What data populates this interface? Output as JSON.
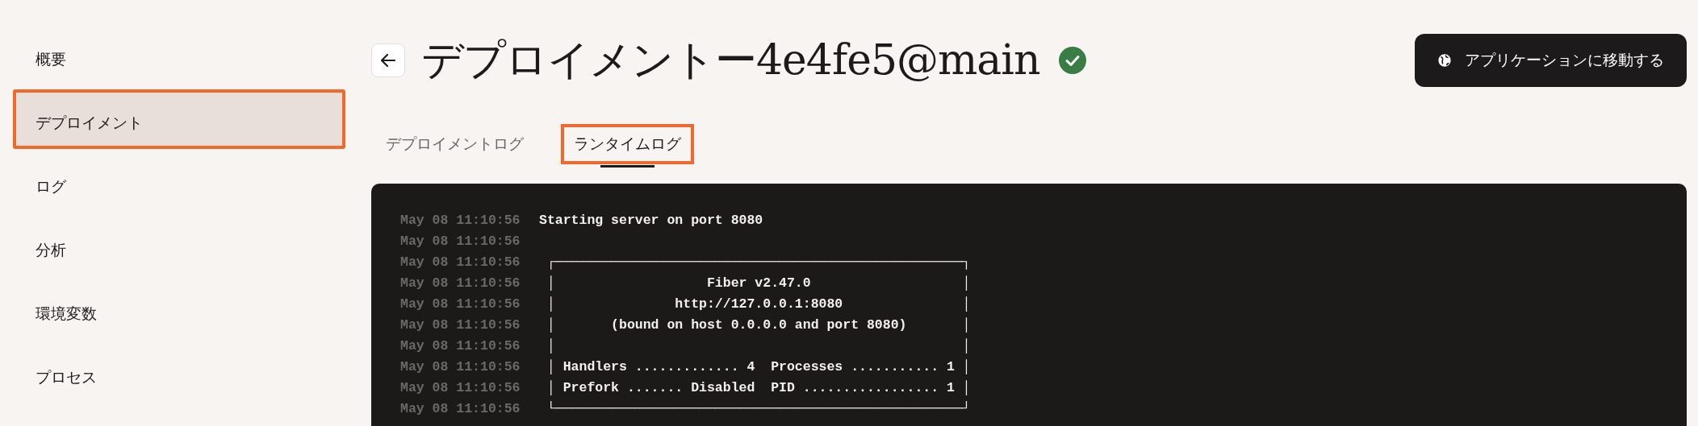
{
  "sidebar": {
    "items": [
      {
        "label": "概要",
        "selected": false,
        "highlighted": false
      },
      {
        "label": "デプロイメント",
        "selected": true,
        "highlighted": true
      },
      {
        "label": "ログ",
        "selected": false,
        "highlighted": false
      },
      {
        "label": "分析",
        "selected": false,
        "highlighted": false
      },
      {
        "label": "環境変数",
        "selected": false,
        "highlighted": false
      },
      {
        "label": "プロセス",
        "selected": false,
        "highlighted": false
      }
    ]
  },
  "header": {
    "title": "デプロイメントー4e4fe5@main",
    "succeeded": true,
    "open_button": "アプリケーションに移動する"
  },
  "tabs": [
    {
      "label": "デプロイメントログ",
      "selected": false,
      "highlighted": false
    },
    {
      "label": "ランタイムログ",
      "selected": true,
      "highlighted": true
    }
  ],
  "log": [
    {
      "time": "May 08 11:10:56",
      "message": "Starting server on port 8080"
    },
    {
      "time": "May 08 11:10:56"
    },
    {
      "time": "May 08 11:10:56",
      "message": " ┌───────────────────────────────────────────────────┐"
    },
    {
      "time": "May 08 11:10:56",
      "message": " │                   Fiber v2.47.0                   │"
    },
    {
      "time": "May 08 11:10:56",
      "message": " │               http://127.0.0.1:8080               │"
    },
    {
      "time": "May 08 11:10:56",
      "message": " │       (bound on host 0.0.0.0 and port 8080)       │"
    },
    {
      "time": "May 08 11:10:56",
      "message": " │                                                   │"
    },
    {
      "time": "May 08 11:10:56",
      "message": " │ Handlers ............. 4  Processes ........... 1 │"
    },
    {
      "time": "May 08 11:10:56",
      "message": " │ Prefork ....... Disabled  PID ................. 1 │"
    },
    {
      "time": "May 08 11:10:56",
      "message": " └───────────────────────────────────────────────────┘"
    }
  ]
}
